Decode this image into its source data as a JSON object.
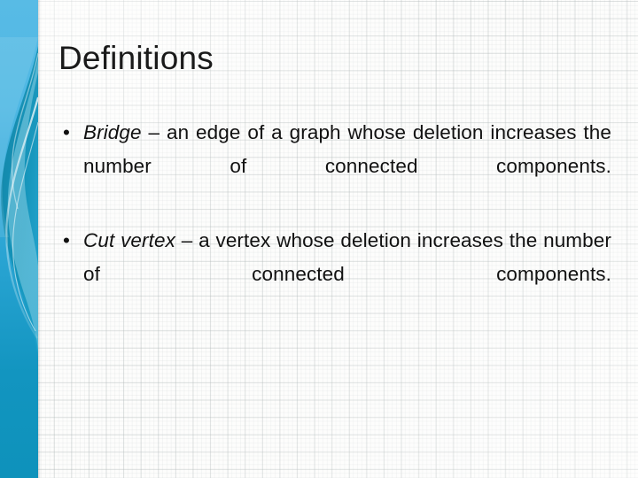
{
  "slide": {
    "title": "Definitions",
    "bullets": [
      {
        "bullet_glyph": "•",
        "term": "Bridge",
        "dash": " – ",
        "definition": "an edge of a graph whose deletion increases the number of connected components."
      },
      {
        "bullet_glyph": "•",
        "term": "Cut vertex",
        "dash": " – ",
        "definition": "a vertex whose deletion increases the number of connected components."
      }
    ]
  },
  "theme": {
    "sidebar_top_color": "#55b9e4",
    "sidebar_bottom_color": "#0e93bc",
    "sidebar_accent_dark": "#0f88ac",
    "sidebar_accent_light": "#bfe8f3",
    "title_color": "#1a1a1a",
    "body_text_color": "#111111",
    "page_background": "#fdfdfc",
    "grid_line_color": "#aab2b2"
  }
}
